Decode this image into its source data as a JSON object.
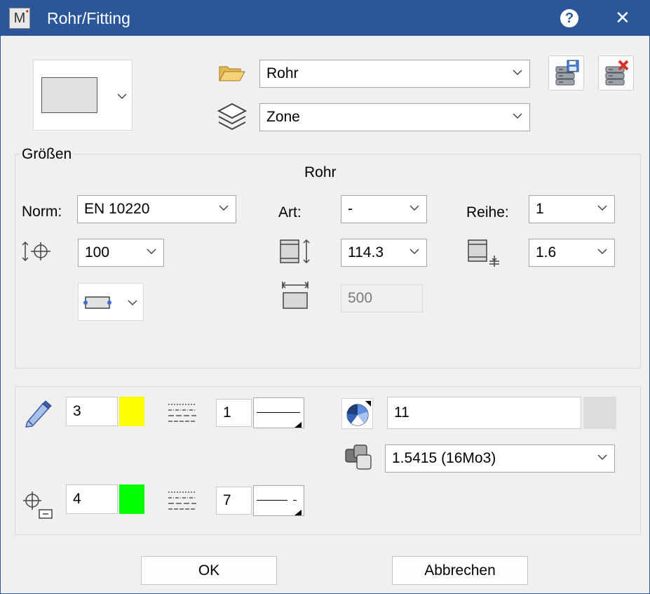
{
  "window": {
    "title": "Rohr/Fitting",
    "app_icon_letter": "M"
  },
  "header": {
    "preset_value": "Rohr",
    "layer_value": "Zone"
  },
  "groessen": {
    "group_label": "Größen",
    "section_title": "Rohr",
    "norm_label": "Norm:",
    "norm_value": "EN 10220",
    "art_label": "Art:",
    "art_value": "-",
    "reihe_label": "Reihe:",
    "reihe_value": "1",
    "dn_value": "100",
    "outer_diameter_value": "114.3",
    "wall_thickness_value": "1.6",
    "length_value": "500"
  },
  "attributes": {
    "pen1_value": "3",
    "pen1_color": "#ffff00",
    "line1_value": "1",
    "pen2_value": "4",
    "pen2_color": "#00ff00",
    "line2_value": "7",
    "layer_number_value": "11",
    "material_value": "1.5415 (16Mo3)"
  },
  "buttons": {
    "ok": "OK",
    "cancel": "Abbrechen"
  }
}
